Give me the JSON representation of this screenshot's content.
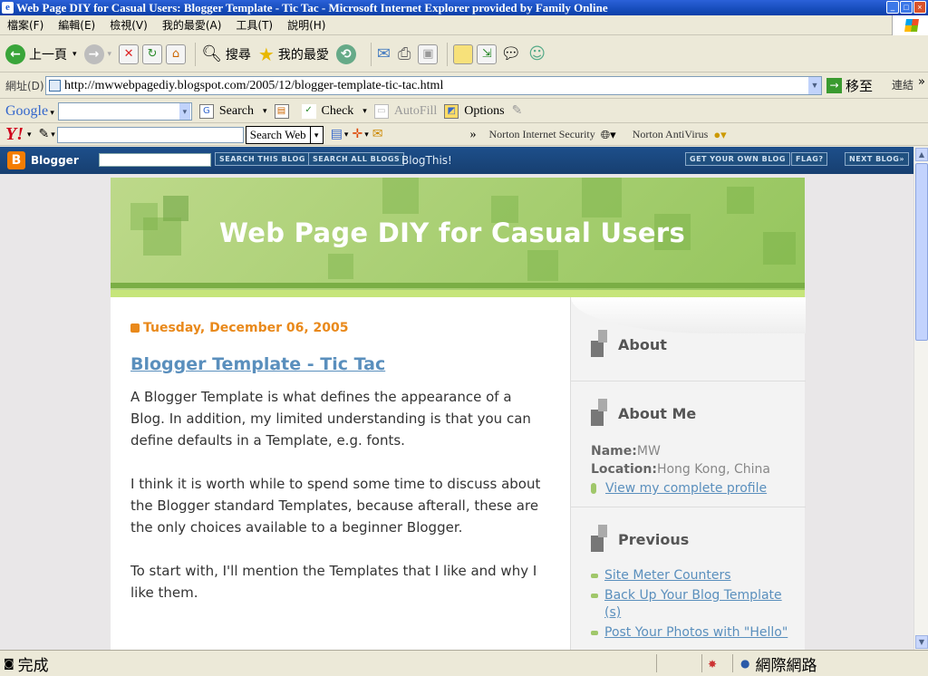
{
  "window": {
    "title": "Web Page DIY for Casual Users: Blogger Template - Tic Tac - Microsoft Internet Explorer provided by Family Online"
  },
  "menu": [
    "檔案(F)",
    "編輯(E)",
    "檢視(V)",
    "我的最愛(A)",
    "工具(T)",
    "說明(H)"
  ],
  "toolbar": {
    "back_label": "上一頁",
    "search_label": "搜尋",
    "favorites_label": "我的最愛"
  },
  "address": {
    "label": "網址(D)",
    "url": "http://mwwebpagediy.blogspot.com/2005/12/blogger-template-tic-tac.html",
    "go_label": "移至",
    "links_label": "連結"
  },
  "google_bar": {
    "logo": "Google",
    "search_label": "Search",
    "check_label": "Check",
    "autofill_label": "AutoFill",
    "options_label": "Options"
  },
  "yahoo_bar": {
    "logo": "Y!",
    "search_web_label": "Search Web",
    "more": "»",
    "norton_security": "Norton Internet Security",
    "norton_antivirus": "Norton AntiVirus"
  },
  "blogger_nav": {
    "logo": "Blogger",
    "search_this": "SEARCH THIS BLOG",
    "search_all": "SEARCH ALL BLOGS",
    "blogthis": "BlogThis!",
    "get_own": "GET YOUR OWN BLOG",
    "flag": "FLAG?",
    "next": "NEXT BLOG»"
  },
  "blog": {
    "title": "Web Page DIY for Casual Users",
    "date": "Tuesday, December 06, 2005",
    "post_title": "Blogger Template - Tic Tac",
    "paragraphs": [
      "A Blogger Template is what defines the appearance of a Blog. In addition, my limited understanding is that you can define defaults in a Template, e.g. fonts.",
      "I think it is worth while to spend some time to discuss about the Blogger standard Templates, because afterall, these are the only choices available to a beginner Blogger.",
      "To start with, I'll mention the Templates that I like and why I like them."
    ]
  },
  "sidebar": {
    "about": "About",
    "about_me": "About Me",
    "name_label": "Name:",
    "name": "MW",
    "location_label": "Location:",
    "location": "Hong Kong, China",
    "profile_link": "View my complete profile",
    "previous": "Previous",
    "previous_posts": [
      "Site Meter Counters",
      "Back Up Your Blog Template (s)",
      "Post Your Photos with \"Hello\""
    ]
  },
  "status": {
    "text": "完成",
    "zone": "網際網路"
  }
}
